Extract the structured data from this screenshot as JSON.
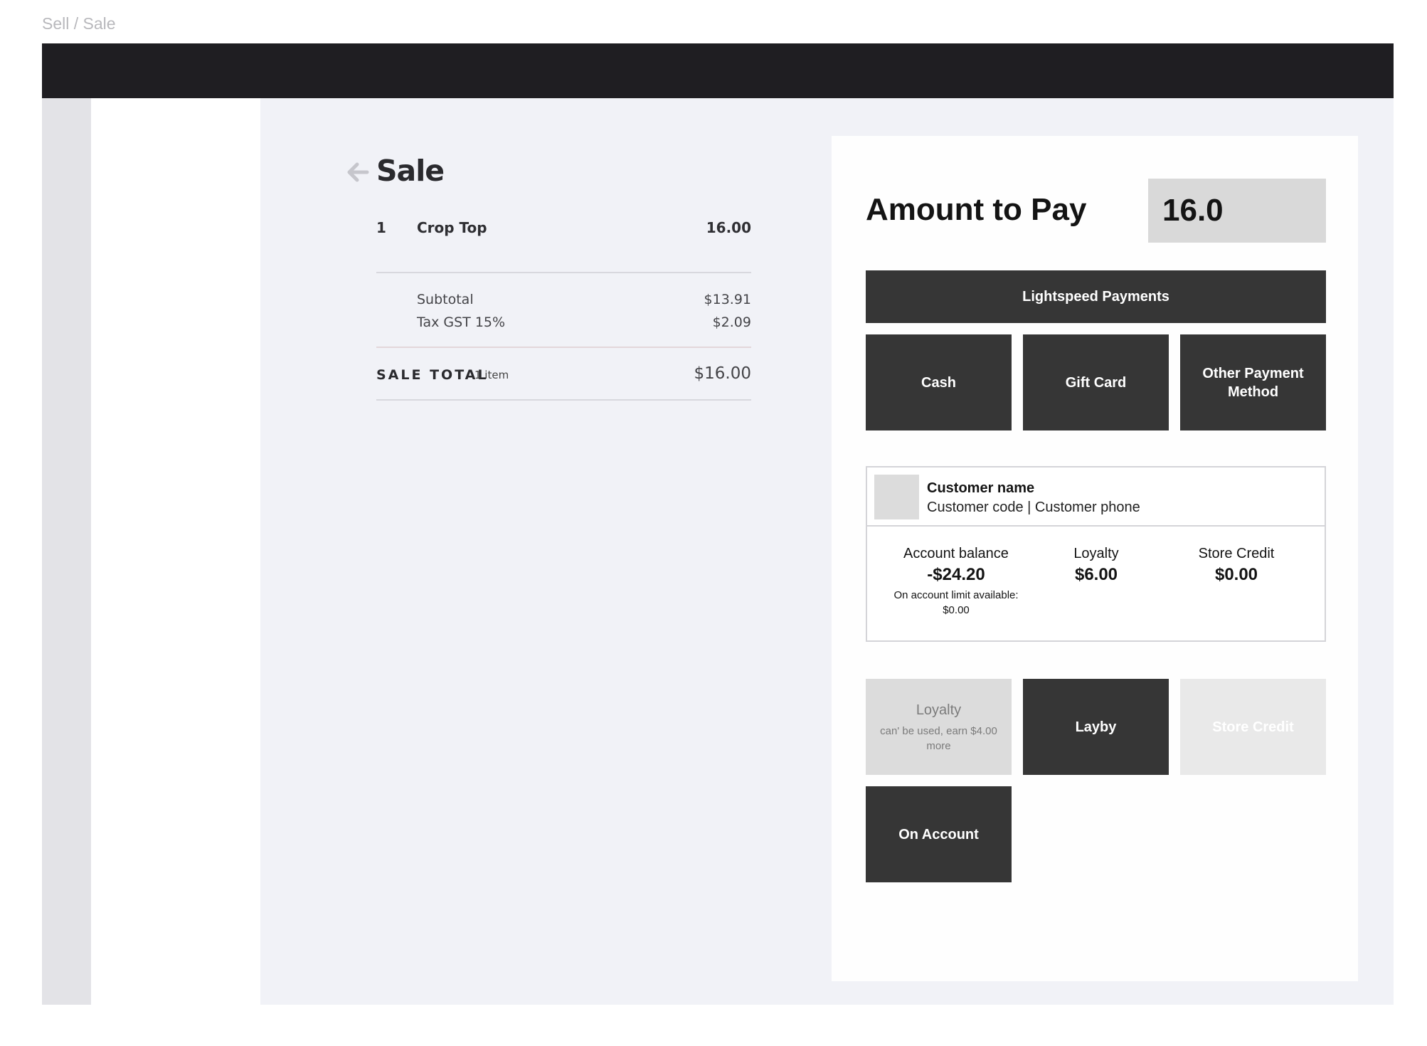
{
  "breadcrumb": "Sell / Sale",
  "sale": {
    "title": "Sale",
    "items": [
      {
        "qty": "1",
        "name": "Crop Top",
        "price": "16.00"
      }
    ],
    "subtotal_label": "Subtotal",
    "subtotal_value": "$13.91",
    "tax_label": "Tax GST 15%",
    "tax_value": "$2.09",
    "total_label": "SALE TOTAL",
    "total_count": "1 item",
    "total_value": "$16.00"
  },
  "payment": {
    "amount_label": "Amount to Pay",
    "amount_value": "16.0",
    "lightspeed_label": "Lightspeed Payments",
    "cash_label": "Cash",
    "giftcard_label": "Gift Card",
    "other_label": "Other Payment Method"
  },
  "customer": {
    "name": "Customer name",
    "subtitle": "Customer code | Customer phone",
    "account_balance_label": "Account balance",
    "account_balance_value": "-$24.20",
    "account_limit_note": "On account limit available: $0.00",
    "loyalty_label": "Loyalty",
    "loyalty_value": "$6.00",
    "store_credit_label": "Store Credit",
    "store_credit_value": "$0.00"
  },
  "account_payments": {
    "loyalty_label": "Loyalty",
    "loyalty_note": "can' be used, earn $4.00 more",
    "layby_label": "Layby",
    "store_credit_label": "Store Credit",
    "on_account_label": "On Account"
  },
  "colors": {
    "topbar": "#1f1e22",
    "button": "#363636",
    "content_bg": "#f1f2f7"
  }
}
